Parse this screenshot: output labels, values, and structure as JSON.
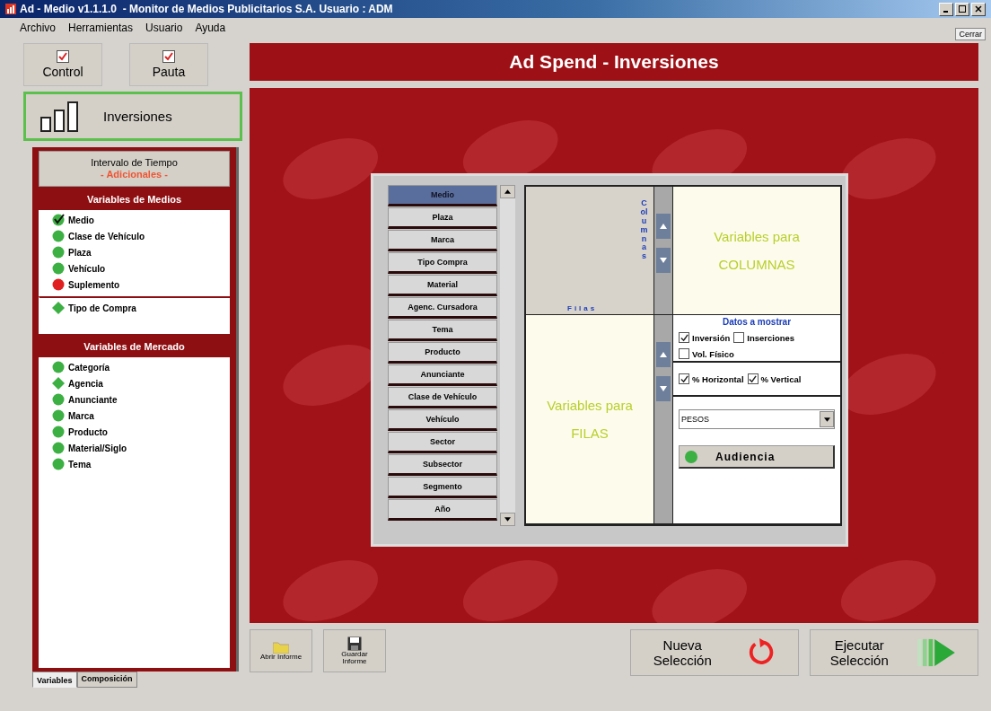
{
  "window": {
    "title": "Ad - Medio v1.1.1.0  - Monitor de Medios Publicitarios S.A. Usuario : ADM",
    "close_label": "Cerrar"
  },
  "menu": [
    "Archivo",
    "Herramientas",
    "Usuario",
    "Ayuda"
  ],
  "modules": [
    {
      "label": "Control",
      "checked": true
    },
    {
      "label": "Pauta",
      "checked": true
    }
  ],
  "active_module": {
    "label": "Inversiones",
    "selected": true
  },
  "time_button": {
    "label": "Intervalo de Tiempo",
    "sublabel": "- Adicionales -"
  },
  "medios": {
    "title": "Variables de Medios",
    "groups": [
      {
        "items": [
          {
            "label": "Medio",
            "kind": "circle",
            "color": "#3cb043",
            "checked": true
          },
          {
            "label": "Clase de Vehículo",
            "kind": "circle",
            "color": "#3cb043",
            "checked": false
          },
          {
            "label": "Plaza",
            "kind": "circle",
            "color": "#3cb043",
            "checked": false
          },
          {
            "label": "Vehículo",
            "kind": "circle",
            "color": "#3cb043",
            "checked": false
          },
          {
            "label": "Suplemento",
            "kind": "circle",
            "color": "#e02020",
            "checked": false
          }
        ]
      },
      {
        "items": [
          {
            "label": "Tipo de Compra",
            "kind": "diamond",
            "color": "#3cb043",
            "checked": false
          }
        ]
      }
    ]
  },
  "mercado": {
    "title": "Variables de Mercado",
    "items": [
      {
        "label": "Categoría",
        "kind": "circle",
        "color": "#3cb043",
        "checked": false
      },
      {
        "label": "Agencia",
        "kind": "diamond",
        "color": "#3cb043",
        "checked": false
      },
      {
        "label": "Anunciante",
        "kind": "circle",
        "color": "#3cb043",
        "checked": false
      },
      {
        "label": "Marca",
        "kind": "circle",
        "color": "#3cb043",
        "checked": false
      },
      {
        "label": "Producto",
        "kind": "circle",
        "color": "#3cb043",
        "checked": false
      },
      {
        "label": "Material/Siglo",
        "kind": "circle",
        "color": "#3cb043",
        "checked": false
      },
      {
        "label": "Tema",
        "kind": "circle",
        "color": "#3cb043",
        "checked": false
      }
    ]
  },
  "panel_tabs": [
    {
      "label": "Variables",
      "selected": true
    },
    {
      "label": "Composición",
      "selected": false
    }
  ],
  "header": "Ad Spend - Inversiones",
  "variables": [
    {
      "label": "Medio",
      "selected": true
    },
    {
      "label": "Plaza",
      "selected": false
    },
    {
      "label": "Marca",
      "selected": false
    },
    {
      "label": "Tipo Compra",
      "selected": false
    },
    {
      "label": "Material",
      "selected": false
    },
    {
      "label": "Agenc. Cursadora",
      "selected": false
    },
    {
      "label": "Tema",
      "selected": false
    },
    {
      "label": "Producto",
      "selected": false
    },
    {
      "label": "Anunciante",
      "selected": false
    },
    {
      "label": "Clase de Vehículo",
      "selected": false
    },
    {
      "label": "Vehículo",
      "selected": false
    },
    {
      "label": "Sector",
      "selected": false
    },
    {
      "label": "Subsector",
      "selected": false
    },
    {
      "label": "Segmento",
      "selected": false
    },
    {
      "label": "Año",
      "selected": false
    }
  ],
  "corner": {
    "columns_label": "Columnas",
    "rows_label": "Filas"
  },
  "columns_drop": {
    "line1": "Variables para",
    "line2": "COLUMNAS"
  },
  "rows_drop": {
    "line1": "Variables para",
    "line2": "FILAS"
  },
  "options": {
    "title": "Datos a mostrar",
    "data": [
      {
        "label": "Inversión",
        "checked": true
      },
      {
        "label": "Inserciones",
        "checked": false
      },
      {
        "label": "Vol. Físico",
        "checked": false
      }
    ],
    "percent": [
      {
        "label": "% Horizontal",
        "checked": true
      },
      {
        "label": "% Vertical",
        "checked": true
      }
    ],
    "currency": "PESOS",
    "audience": {
      "label": "Audiencia",
      "color": "#3cb043"
    }
  },
  "file_buttons": [
    {
      "label": "Abrir Informe",
      "kind": "open"
    },
    {
      "label": "Guardar Informe",
      "kind": "save"
    }
  ],
  "actions": [
    {
      "line1": "Nueva",
      "line2": "Selección",
      "kind": "reset"
    },
    {
      "line1": "Ejecutar",
      "line2": "Selección",
      "kind": "run"
    }
  ]
}
